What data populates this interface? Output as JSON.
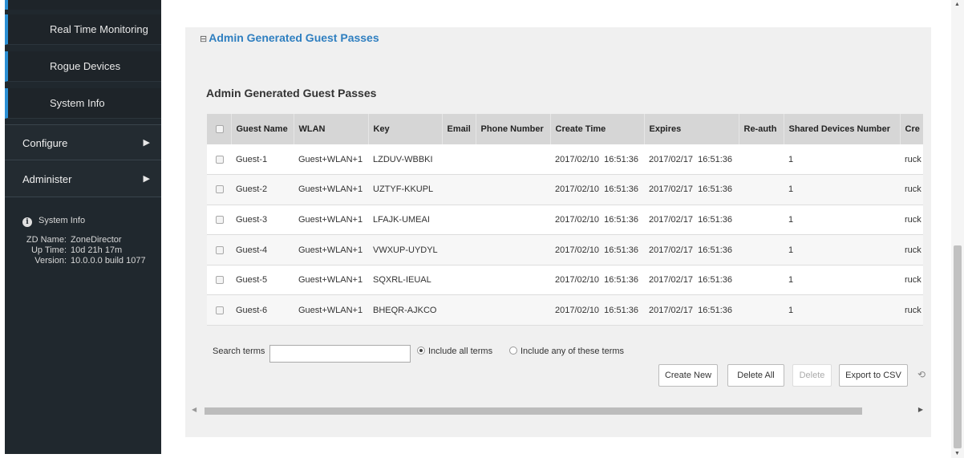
{
  "sidebar": {
    "submenu": [
      "Real Time Monitoring",
      "Rogue Devices",
      "System Info"
    ],
    "configure": "Configure",
    "administer": "Administer",
    "arrow_glyph": "▶",
    "system_info": {
      "title": "System Info",
      "rows": [
        {
          "k": "ZD Name:",
          "v": "ZoneDirector"
        },
        {
          "k": "Up Time:",
          "v": "10d 21h 17m"
        },
        {
          "k": "Version:",
          "v": "10.0.0.0 build 1077"
        }
      ]
    }
  },
  "section": {
    "toggle_label": "Admin Generated Guest Passes",
    "table_title": "Admin Generated Guest Passes"
  },
  "table": {
    "columns": [
      "Guest Name",
      "WLAN",
      "Key",
      "Email",
      "Phone Number",
      "Create Time",
      "Expires",
      "Re-auth",
      "Shared Devices Number",
      "Cre"
    ],
    "rows": [
      {
        "name": "Guest-1",
        "wlan": "Guest+WLAN+1",
        "key": "LZDUV-WBBKI",
        "email": "",
        "phone": "",
        "create": "2017/02/10  16:51:36",
        "expires": "2017/02/17  16:51:36",
        "reauth": "",
        "shared": "1",
        "creator": "ruck"
      },
      {
        "name": "Guest-2",
        "wlan": "Guest+WLAN+1",
        "key": "UZTYF-KKUPL",
        "email": "",
        "phone": "",
        "create": "2017/02/10  16:51:36",
        "expires": "2017/02/17  16:51:36",
        "reauth": "",
        "shared": "1",
        "creator": "ruck"
      },
      {
        "name": "Guest-3",
        "wlan": "Guest+WLAN+1",
        "key": "LFAJK-UMEAI",
        "email": "",
        "phone": "",
        "create": "2017/02/10  16:51:36",
        "expires": "2017/02/17  16:51:36",
        "reauth": "",
        "shared": "1",
        "creator": "ruck"
      },
      {
        "name": "Guest-4",
        "wlan": "Guest+WLAN+1",
        "key": "VWXUP-UYDYL",
        "email": "",
        "phone": "",
        "create": "2017/02/10  16:51:36",
        "expires": "2017/02/17  16:51:36",
        "reauth": "",
        "shared": "1",
        "creator": "ruck"
      },
      {
        "name": "Guest-5",
        "wlan": "Guest+WLAN+1",
        "key": "SQXRL-IEUAL",
        "email": "",
        "phone": "",
        "create": "2017/02/10  16:51:36",
        "expires": "2017/02/17  16:51:36",
        "reauth": "",
        "shared": "1",
        "creator": "ruck"
      },
      {
        "name": "Guest-6",
        "wlan": "Guest+WLAN+1",
        "key": "BHEQR-AJKCO",
        "email": "",
        "phone": "",
        "create": "2017/02/10  16:51:36",
        "expires": "2017/02/17  16:51:36",
        "reauth": "",
        "shared": "1",
        "creator": "ruck"
      }
    ]
  },
  "search": {
    "label": "Search terms",
    "value": "",
    "option_all": "Include all terms",
    "option_any": "Include any of these terms",
    "selected": "all"
  },
  "buttons": {
    "create_new": "Create New",
    "delete_all": "Delete All",
    "delete": "Delete",
    "export_csv": "Export to CSV"
  },
  "colors": {
    "sidebar_bg": "#20282e",
    "accent": "#2a8fd4",
    "link": "#2f7fc0"
  }
}
